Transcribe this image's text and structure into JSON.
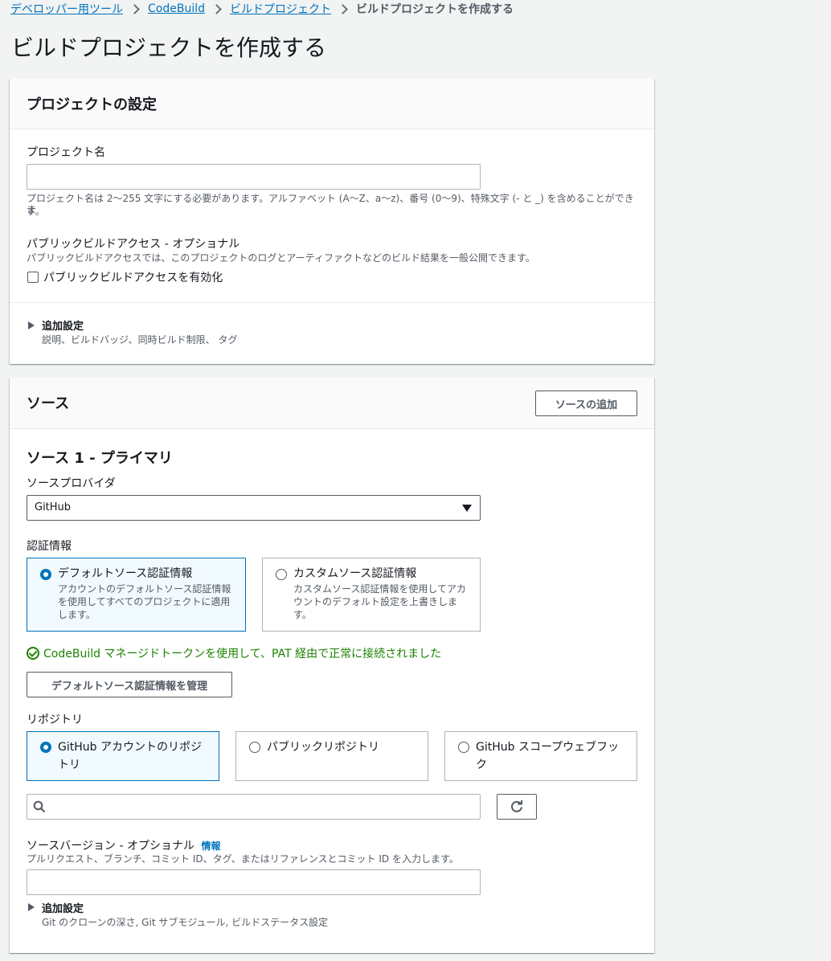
{
  "breadcrumb": {
    "items": [
      "デベロッパー用ツール",
      "CodeBuild",
      "ビルドプロジェクト"
    ],
    "current": "ビルドプロジェクトを作成する"
  },
  "page": {
    "title": "ビルドプロジェクトを作成する"
  },
  "project_settings": {
    "title": "プロジェクトの設定",
    "name_label": "プロジェクト名",
    "name_value": "",
    "name_hint_line1": "プロジェクト名は 2〜255 文字にする必要があります。アルファベット (A〜Z、a〜z)、番号 (0〜9)、特殊文字 (- と _) を含めることができま",
    "name_hint_line2": "す。",
    "public_access_label": "パブリックビルドアクセス - オプショナル",
    "public_access_desc": "パブリックビルドアクセスでは、このプロジェクトのログとアーティファクトなどのビルド結果を一般公開できます。",
    "public_access_checkbox": "パブリックビルドアクセスを有効化",
    "public_access_checked": false,
    "additional_label": "追加設定",
    "additional_desc": "説明、ビルドバッジ、同時ビルド制限、 タグ"
  },
  "source": {
    "title": "ソース",
    "add_source_button": "ソースの追加",
    "primary_title": "ソース 1 - プライマリ",
    "provider_label": "ソースプロバイダ",
    "provider_value": "GitHub",
    "credentials_label": "認証情報",
    "credential_options": [
      {
        "label": "デフォルトソース認証情報",
        "desc_lines": [
          "アカウントのデフォルトソース認証情報",
          "を使用してすべてのプロジェクトに適用",
          "します。"
        ],
        "selected": true
      },
      {
        "label": "カスタムソース認証情報",
        "desc_lines": [
          "カスタムソース認証情報を使用してアカ",
          "ウントのデフォルト設定を上書きしま",
          "す。"
        ],
        "selected": false
      }
    ],
    "connection_status": "CodeBuild マネージドトークンを使用して、PAT 経由で正常に接続されました",
    "manage_credentials_button": "デフォルトソース認証情報を管理",
    "repository_label": "リポジトリ",
    "repository_options": [
      {
        "label_lines": [
          "GitHub アカウントのリポジ",
          "トリ"
        ],
        "selected": true
      },
      {
        "label_lines": [
          "パブリックリポジトリ"
        ],
        "selected": false
      },
      {
        "label_lines": [
          "GitHub スコープウェブフッ",
          "ク"
        ],
        "selected": false
      }
    ],
    "repo_search_value": "",
    "source_version_label": "ソースバージョン - オプショナル",
    "info_link": "情報",
    "source_version_desc": "プルリクエスト、ブランチ、コミット ID、タグ、またはリファレンスとコミット ID を入力します。",
    "source_version_value": "",
    "additional_label": "追加設定",
    "additional_desc": "Git のクローンの深さ, Git サブモジュール, ビルドステータス設定"
  },
  "colors": {
    "link": "#0073bb",
    "success": "#1d8102",
    "selected_bg": "#f1faff"
  }
}
